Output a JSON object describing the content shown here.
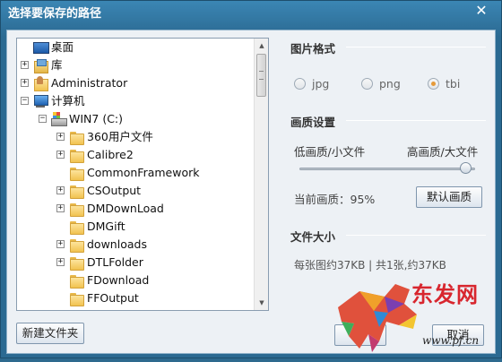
{
  "window": {
    "title": "选择要保存的路径",
    "close_glyph": "✕"
  },
  "tree": {
    "items": [
      {
        "label": "桌面",
        "icon": "desktop-icon",
        "level": 0,
        "expander": ""
      },
      {
        "label": "库",
        "icon": "library-icon",
        "level": 0,
        "expander": "+"
      },
      {
        "label": "Administrator",
        "icon": "user-folder-icon",
        "level": 0,
        "expander": "+"
      },
      {
        "label": "计算机",
        "icon": "computer-icon",
        "level": 0,
        "expander": "−"
      },
      {
        "label": "WIN7 (C:)",
        "icon": "drive-icon",
        "level": 1,
        "expander": "−"
      },
      {
        "label": "360用户文件",
        "icon": "folder-icon",
        "level": 2,
        "expander": "+"
      },
      {
        "label": "Calibre2",
        "icon": "folder-icon",
        "level": 2,
        "expander": "+"
      },
      {
        "label": "CommonFramework",
        "icon": "folder-icon",
        "level": 2,
        "expander": ""
      },
      {
        "label": "CSOutput",
        "icon": "folder-icon",
        "level": 2,
        "expander": "+"
      },
      {
        "label": "DMDownLoad",
        "icon": "folder-icon",
        "level": 2,
        "expander": "+"
      },
      {
        "label": "DMGift",
        "icon": "folder-icon",
        "level": 2,
        "expander": ""
      },
      {
        "label": "downloads",
        "icon": "folder-icon",
        "level": 2,
        "expander": "+"
      },
      {
        "label": "DTLFolder",
        "icon": "folder-icon",
        "level": 2,
        "expander": "+"
      },
      {
        "label": "FDownload",
        "icon": "folder-icon",
        "level": 2,
        "expander": ""
      },
      {
        "label": "FFOutput",
        "icon": "folder-icon",
        "level": 2,
        "expander": ""
      },
      {
        "label": "",
        "icon": "folder-icon",
        "level": 2,
        "expander": ""
      }
    ],
    "scroll_up_glyph": "▲",
    "scroll_down_glyph": "▼"
  },
  "buttons": {
    "new_folder": "新建文件夹",
    "default_quality": "默认画质",
    "ok": "",
    "cancel": "取消"
  },
  "format": {
    "title": "图片格式",
    "options": [
      "jpg",
      "png",
      "tbi"
    ],
    "selected": "tbi"
  },
  "quality": {
    "title": "画质设置",
    "low_label": "低画质/小文件",
    "high_label": "高画质/大文件",
    "value_percent": 95,
    "current_text": "当前画质：95%"
  },
  "size": {
    "title": "文件大小",
    "text": "每张图约37KB | 共1张,约37KB"
  },
  "watermark": {
    "brand": "东发网",
    "url": "www.pf.cn"
  },
  "colors": {
    "title_bar": "#2b6a92",
    "accent_radio": "#e59a3a",
    "watermark_red": "#d8262e"
  }
}
